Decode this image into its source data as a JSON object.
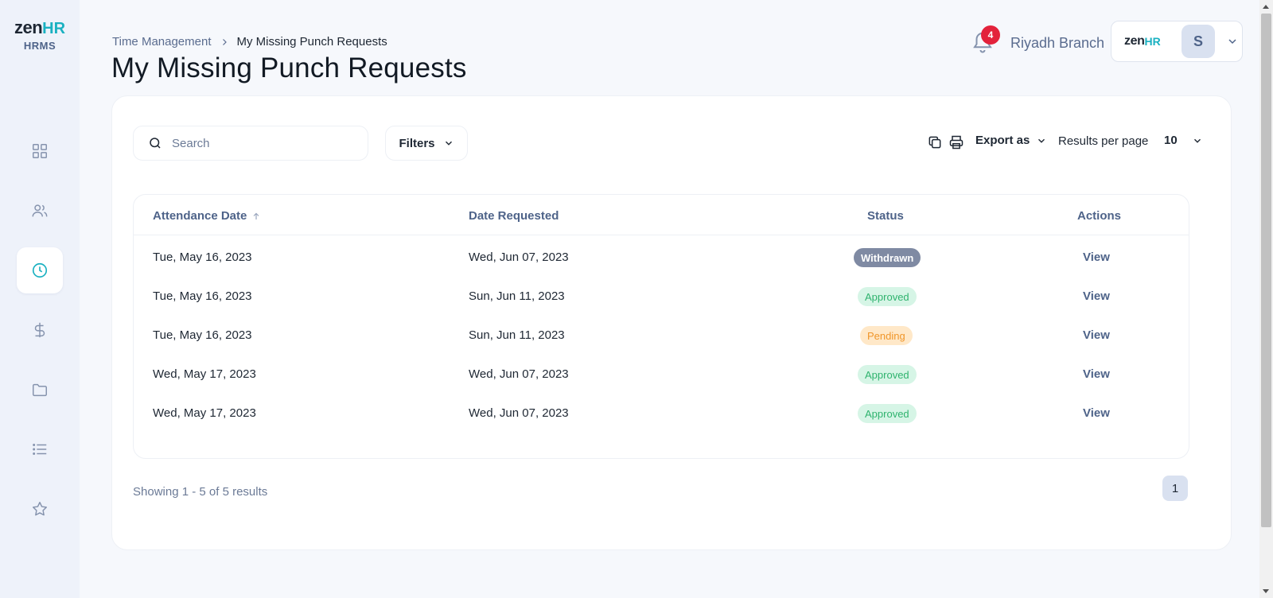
{
  "brand": {
    "logo_zen": "zen",
    "logo_hr": "HR",
    "product": "HRMS"
  },
  "sidebar": {
    "items": [
      {
        "icon": "dashboard-grid-icon",
        "active": false
      },
      {
        "icon": "people-icon",
        "active": false
      },
      {
        "icon": "clock-icon",
        "active": true
      },
      {
        "icon": "dollar-icon",
        "active": false
      },
      {
        "icon": "folder-icon",
        "active": false
      },
      {
        "icon": "list-icon",
        "active": false
      },
      {
        "icon": "star-icon",
        "active": false
      }
    ]
  },
  "breadcrumb": {
    "parent": "Time Management",
    "current": "My Missing Punch Requests"
  },
  "page_title": "My Missing Punch Requests",
  "header": {
    "notification_count": "4",
    "branch": "Riyadh Branch",
    "account_logo_zen": "zen",
    "account_logo_hr": "HR",
    "avatar_initial": "S"
  },
  "toolbar": {
    "search_placeholder": "Search",
    "filters_label": "Filters",
    "export_label": "Export as",
    "results_per_page_label": "Results per page",
    "results_per_page_value": "10"
  },
  "table": {
    "columns": {
      "attendance_date": "Attendance Date",
      "date_requested": "Date Requested",
      "status": "Status",
      "actions": "Actions"
    },
    "sort": {
      "column": "attendance_date",
      "direction": "ascending"
    },
    "rows": [
      {
        "attendance_date": "Tue, May 16, 2023",
        "date_requested": "Wed, Jun 07, 2023",
        "status": "Withdrawn",
        "action": "View"
      },
      {
        "attendance_date": "Tue, May 16, 2023",
        "date_requested": "Sun, Jun 11, 2023",
        "status": "Approved",
        "action": "View"
      },
      {
        "attendance_date": "Tue, May 16, 2023",
        "date_requested": "Sun, Jun 11, 2023",
        "status": "Pending",
        "action": "View"
      },
      {
        "attendance_date": "Wed, May 17, 2023",
        "date_requested": "Wed, Jun 07, 2023",
        "status": "Approved",
        "action": "View"
      },
      {
        "attendance_date": "Wed, May 17, 2023",
        "date_requested": "Wed, Jun 07, 2023",
        "status": "Approved",
        "action": "View"
      }
    ]
  },
  "footer": {
    "showing_text": "Showing 1 - 5 of 5 results",
    "current_page": "1"
  },
  "colors": {
    "accent_teal": "#1ab1c1",
    "label_blue": "#4e6389",
    "notification_red": "#e3223b",
    "withdrawn_bg": "#7f8aa3",
    "approved_bg": "#d6f5e6",
    "approved_text": "#2fb36e",
    "pending_bg": "#ffe8c8",
    "pending_text": "#f0962a"
  }
}
